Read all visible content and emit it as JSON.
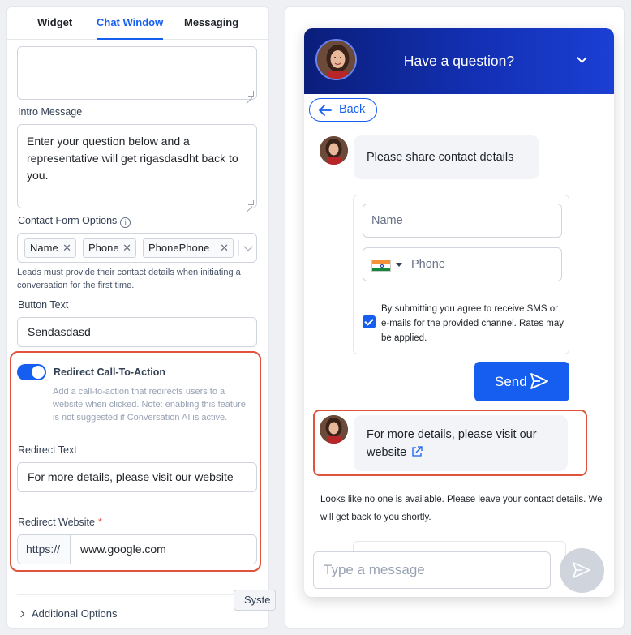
{
  "settings": {
    "tabs": [
      {
        "label": "Widget"
      },
      {
        "label": "Chat Window"
      },
      {
        "label": "Messaging"
      }
    ],
    "active_tab": "Chat Window",
    "intro_message": {
      "label": "Intro Message",
      "value": "Enter your question below and a representative will get rigasdasdht back to you."
    },
    "contact_form": {
      "label": "Contact Form Options",
      "chips": [
        "Name",
        "Phone",
        "PhonePhone"
      ],
      "helper": "Leads must provide their contact details when initiating a conversation for the first time."
    },
    "button_text": {
      "label": "Button Text",
      "value": "Sendasdasd"
    },
    "redirect": {
      "toggle_label": "Redirect Call-To-Action",
      "toggle_on": true,
      "helper": "Add a call-to-action that redirects users to a website when clicked. Note: enabling this feature is not suggested if Conversation AI is active.",
      "text_label": "Redirect Text",
      "text_value": "For more details, please visit our website",
      "website_label": "Redirect Website",
      "required_mark": "*",
      "url_prefix": "https://",
      "url_value": "www.google.com"
    },
    "additional_options": "Additional Options",
    "tooltip": "Syste"
  },
  "preview": {
    "header_title": "Have a question?",
    "back_label": "Back",
    "contact_prompt": "Please share contact details",
    "form": {
      "name_placeholder": "Name",
      "phone_placeholder": "Phone",
      "consent": "By submitting you agree to receive SMS or e-mails for the provided channel. Rates may be applied.",
      "consent_checked": true
    },
    "send_label": "Send",
    "redirect_line1": "For more details, please visit our",
    "redirect_line2": "website",
    "notice": "Looks like no one is available. Please leave your contact details. We will get back to you shortly.",
    "composer_placeholder": "Type a message"
  },
  "colors": {
    "accent": "#155eef",
    "header_start": "#0a1e7a",
    "header_end": "#1b3fd4",
    "highlight": "#e0533d"
  },
  "icons": [
    "info-icon",
    "close-icon",
    "chevron-down-icon",
    "arrow-left-icon",
    "send-icon",
    "external-link-icon",
    "india-flag-icon",
    "check-icon",
    "chevron-right-icon"
  ]
}
